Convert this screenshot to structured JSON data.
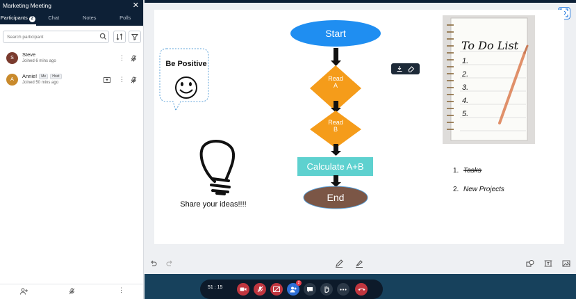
{
  "sidebar": {
    "title": "Marketing Meeting",
    "close_glyph": "✕",
    "tabs": [
      {
        "label": "Participants",
        "count": "2"
      },
      {
        "label": "Chat"
      },
      {
        "label": "Notes"
      },
      {
        "label": "Polls"
      }
    ],
    "search_placeholder": "Search participant",
    "participants": [
      {
        "initial": "S",
        "name": "Steve",
        "joined": "Joined 6 mins ago",
        "avatar_color": "#7a3b2e",
        "tags": []
      },
      {
        "initial": "A",
        "name": "Annie!",
        "joined": "Joined 50 mins ago",
        "avatar_color": "#c98a2c",
        "tags": [
          "Me",
          "Host"
        ]
      }
    ]
  },
  "board": {
    "be_positive": "Be Positive",
    "share_ideas": "Share your ideas!!!!",
    "flow": {
      "start": "Start",
      "read_a": [
        "Read",
        "A"
      ],
      "read_b": [
        "Read",
        "B"
      ],
      "calc": "Calculate A+B",
      "end": "End"
    },
    "todo_title": "To Do List",
    "todo_numbers": [
      "1.",
      "2.",
      "3.",
      "4.",
      "5."
    ],
    "list_items": [
      {
        "num": "1.",
        "text": "Tasks",
        "struck": true
      },
      {
        "num": "2.",
        "text": "New Projects",
        "struck": false
      }
    ]
  },
  "meeting": {
    "timer": "51 : 15",
    "participants_badge": "2"
  },
  "colors": {
    "start_fill": "#1f8ef1",
    "diamond_fill": "#f59c1a",
    "calc_fill": "#5ed1cf",
    "end_fill": "#7b5646",
    "navy": "#0d2036",
    "meeting_bar": "#17415c"
  }
}
